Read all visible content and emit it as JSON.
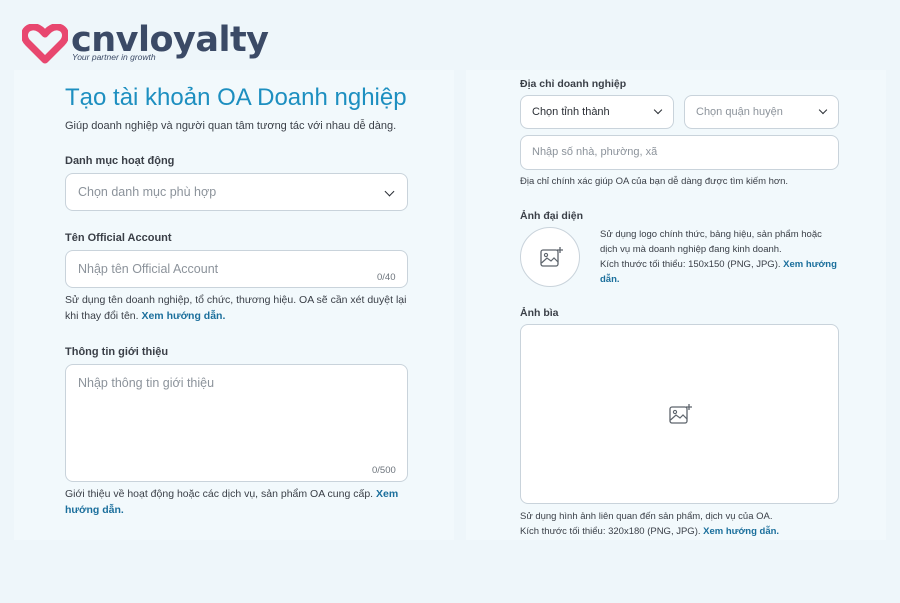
{
  "brand": {
    "name": "cnvloyalty",
    "tagline": "Your partner in growth",
    "heart_color": "#e8476f"
  },
  "form": {
    "title": "Tạo tài khoản OA Doanh nghiệp",
    "subtitle": "Giúp doanh nghiệp và người quan tâm tương tác với nhau dễ dàng.",
    "category": {
      "label": "Danh mục hoạt động",
      "placeholder": "Chọn danh mục phù hợp"
    },
    "oa_name": {
      "label": "Tên Official Account",
      "placeholder": "Nhập tên Official Account",
      "counter": "0/40",
      "help": "Sử dụng tên doanh nghiệp, tổ chức, thương hiệu. OA sẽ cần xét duyệt lại khi thay đổi tên.",
      "link": "Xem hướng dẫn."
    },
    "intro": {
      "label": "Thông tin giới thiệu",
      "placeholder": "Nhập thông tin giới thiệu",
      "counter": "0/500",
      "help": "Giới thiệu về hoạt động hoặc các dịch vụ, sản phẩm OA cung cấp.",
      "link": "Xem hướng dẫn."
    },
    "address": {
      "label": "Địa chỉ doanh nghiệp",
      "province": "Chọn tỉnh thành",
      "district": "Chọn quận huyện",
      "street_placeholder": "Nhập số nhà, phường, xã",
      "help": "Địa chỉ chính xác giúp OA của bạn dễ dàng được tìm kiếm hơn."
    },
    "avatar": {
      "label": "Ảnh đại diện",
      "help": "Sử dụng logo chính thức, bảng hiệu, sản phẩm hoặc dịch vụ mà doanh nghiệp đang kinh doanh.",
      "size": "Kích thước tối thiểu: 150x150 (PNG, JPG).",
      "link": "Xem hướng dẫn."
    },
    "cover": {
      "label": "Ảnh bìa",
      "help": "Sử dụng hình ảnh liên quan đến sản phẩm, dịch vụ của OA.",
      "size": "Kích thước tối thiểu: 320x180 (PNG, JPG).",
      "link": "Xem hướng dẫn."
    }
  }
}
